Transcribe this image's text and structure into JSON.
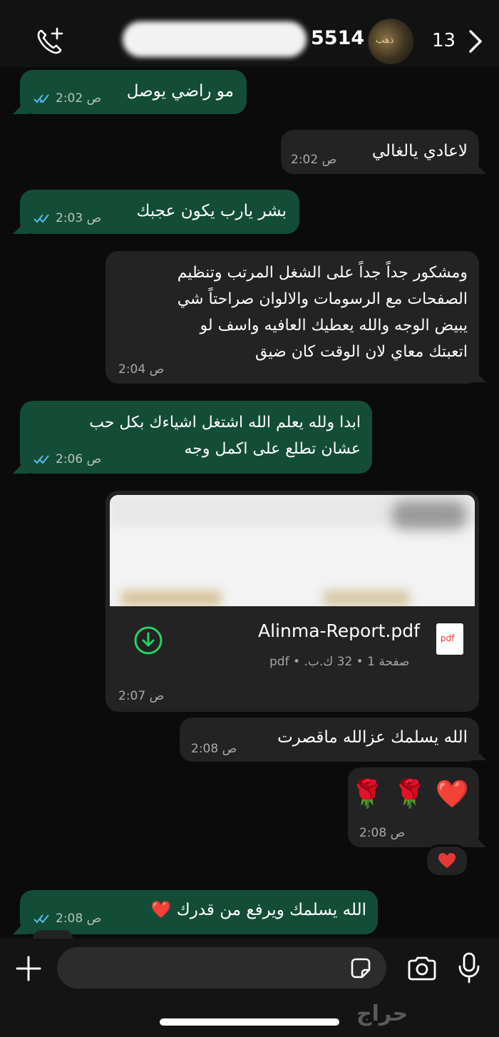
{
  "header": {
    "contact_number_visible": "5514",
    "unread_count": "13",
    "avatar_text": "ذهب"
  },
  "messages": [
    {
      "text": "مو راضي يوصل",
      "time": "2:02 ص"
    },
    {
      "text": "لاعادي يالغالي",
      "time": "2:02 ص"
    },
    {
      "text": "بشر يارب يكون عجبك",
      "time": "2:03 ص"
    },
    {
      "text": "ومشكور جداً جداً على الشغل المرتب وتنظيم\nالصفحات مع الرسومات والالوان صراحتاً شي\nيبيض الوجه والله يعطيك العافيه واسف لو\nاتعبتك معاي لان الوقت كان ضيق",
      "time": "2:04 ص"
    },
    {
      "text": "ابدا ولله يعلم الله اشتغل اشياءك بكل حب\nعشان تطلع على اكمل وجه",
      "time": "2:06 ص"
    },
    {
      "text": "الله يسلمك عزالله ماقصرت",
      "time": "2:08 ص"
    },
    {
      "text": "❤️ 🌹 🌹",
      "time": "2:08 ص"
    },
    {
      "text": "الله يسلمك ويرفع من قدرك ❤️",
      "time": "2:08 ص"
    }
  ],
  "attachment": {
    "file_name": "Alinma-Report.pdf",
    "details": "صفحة 1 • 32 ك.ب. • pdf",
    "icon_label": "pdf",
    "time": "2:07 ص"
  },
  "reaction": "❤️",
  "composer": {
    "placeholder": ""
  },
  "watermark": "حراج",
  "colors": {
    "outgoing_bubble": "#144d37",
    "incoming_bubble": "#232323",
    "read_ticks": "#53bdeb",
    "download_icon": "#25d366"
  }
}
